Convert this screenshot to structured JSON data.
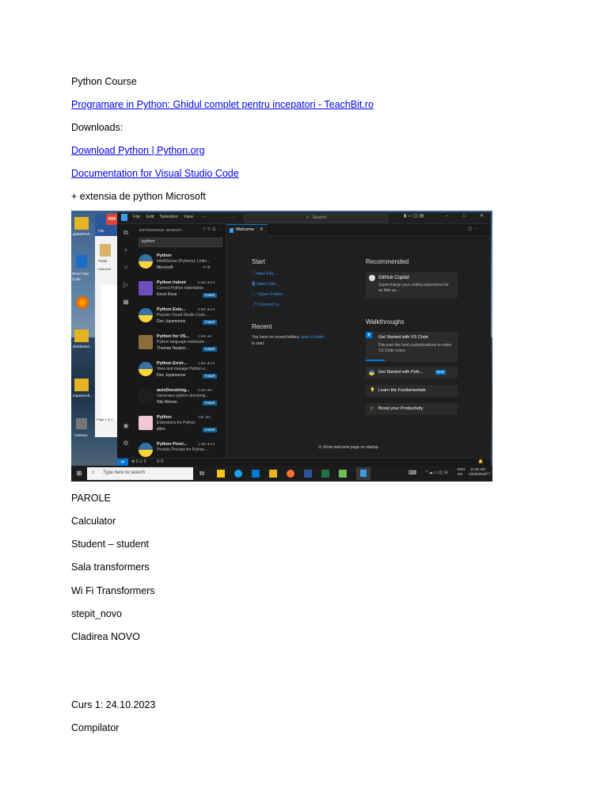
{
  "doc": {
    "course_title": "Python Course",
    "link1": "Programare in Python: Ghidul complet pentru incepatori - TeachBit.ro",
    "downloads": "Downloads:",
    "link2": "Download Python | Python.org",
    "link3": "Documentation for Visual Studio Code",
    "extension_note": "+ extensia de python Microsoft",
    "passwords_heading": "PAROLE",
    "lines": [
      "Calculator",
      "Student – student",
      "Sala transformers",
      "Wi Fi Transformers",
      "stepit_novo",
      "Cladirea NOVO"
    ],
    "course1": "Curs 1: 24.10.2023",
    "compiler": "Compilator"
  },
  "screenshot": {
    "menu": [
      "File",
      "Edit",
      "Selection",
      "View",
      "···"
    ],
    "search_label": "Search",
    "panel_title": "EXTENSIONS: MARKET...",
    "search_value": "python",
    "extensions": [
      {
        "name": "Python",
        "desc": "IntelliSense (Pylance), Lintin...",
        "author": "Microsoft",
        "stats": ""
      },
      {
        "name": "Python Indent",
        "desc": "Correct Python indentation",
        "author": "Kevin Rose",
        "stats": "6.8M ★4.5"
      },
      {
        "name": "Python Exte...",
        "desc": "Popular Visual Studio Code ...",
        "author": "Don Jayamanne",
        "stats": "6.8M ★4.5"
      },
      {
        "name": "Python for VS...",
        "desc": "Python language extension ...",
        "author": "Thomas Haakon...",
        "stats": "1.9M ★2"
      },
      {
        "name": "Python Envir...",
        "desc": "View and manage Python e...",
        "author": "Don Jayamanne",
        "stats": "1.8M ★3.5"
      },
      {
        "name": "autoDocstring...",
        "desc": "Generates python docstring...",
        "author": "Nils Werner",
        "stats": "6.0M ★5"
      },
      {
        "name": "Python",
        "desc": "Extensions for Python",
        "author": "shiro",
        "stats": "74K ★5"
      },
      {
        "name": "Python Previ...",
        "desc": "Provide Preview for Python ...",
        "author": "",
        "stats": "1.3M ★4.5"
      }
    ],
    "install_label": "Install",
    "tab_label": "Welcome",
    "start_heading": "Start",
    "start_items": [
      "New File...",
      "Open File...",
      "Open Folder...",
      "Connect to..."
    ],
    "recent_heading": "Recent",
    "recent_text": "You have no recent folders,",
    "recent_link": "open a folder",
    "recent_text2": "to start.",
    "recommended_heading": "Recommended",
    "copilot_title": "GitHub Copilot",
    "copilot_desc": "Supercharge your coding experience for as little as...",
    "walkthroughs_heading": "Walkthroughs",
    "walk1_title": "Get Started with VS Code",
    "walk1_desc": "Discover the best customizations to make VS Code yours.",
    "walk2_title": "Get Started with Pyth...",
    "walk2_badge": "New",
    "walk3_title": "Learn the Fundamentals",
    "walk4_title": "Boost your Productivity",
    "show_welcome": "Show welcome page on startup",
    "status_left": "⊗ 0 ⚠ 0",
    "status_ports": "0",
    "taskbar_search": "Type here to search",
    "tray_lang": "ENG",
    "tray_region": "US",
    "tray_time": "11:30 AM",
    "tray_date": "10/30/2023",
    "desktop_labels": [
      "globalTech...",
      "Word Visio Code",
      "distributed...",
      "Imparesoft...",
      "Camera",
      "Recycle"
    ],
    "word_labels": [
      "File",
      "Paste",
      "Clipboard",
      "Page 1 of 1"
    ],
    "pdf_label": "PDF"
  }
}
